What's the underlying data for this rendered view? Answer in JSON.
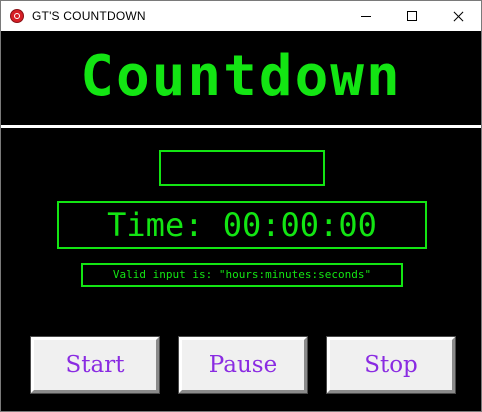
{
  "window": {
    "title": "GT'S COUNTDOWN"
  },
  "header": {
    "title": "Countdown"
  },
  "input": {
    "value": "",
    "placeholder": ""
  },
  "display": {
    "time_text": "Time: 00:00:00"
  },
  "hint": {
    "text": "Valid input is: \"hours:minutes:seconds\""
  },
  "controls": {
    "start_label": "Start",
    "pause_label": "Pause",
    "stop_label": "Stop"
  },
  "colors": {
    "accent": "#13e513",
    "background": "#000000",
    "button_text": "#8a2be2",
    "divider": "#ffffff"
  },
  "icons": {
    "app": "record-icon",
    "minimize": "minimize-icon",
    "maximize": "maximize-icon",
    "close": "close-icon"
  }
}
